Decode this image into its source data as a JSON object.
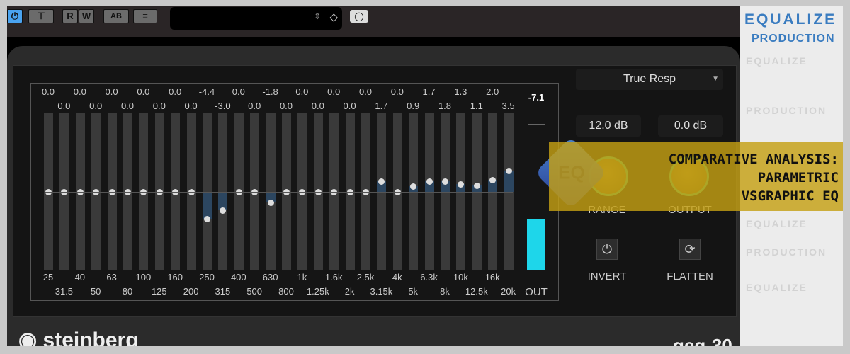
{
  "toolbar": {
    "buttons": [
      "power",
      "T",
      "R",
      "W",
      "AB",
      "≡"
    ],
    "preset_value": "",
    "camera": "camera-icon"
  },
  "bands": {
    "freqs": [
      "25",
      "31.5",
      "40",
      "50",
      "63",
      "80",
      "100",
      "125",
      "160",
      "200",
      "250",
      "315",
      "400",
      "500",
      "630",
      "800",
      "1k",
      "1.25k",
      "1.6k",
      "2k",
      "2.5k",
      "3.15k",
      "4k",
      "5k",
      "6.3k",
      "8k",
      "10k",
      "12.5k",
      "16k",
      "20k"
    ],
    "gains": [
      "0.0",
      "0.0",
      "0.0",
      "0.0",
      "0.0",
      "0.0",
      "0.0",
      "0.0",
      "0.0",
      "0.0",
      "-4.4",
      "-3.0",
      "0.0",
      "0.0",
      "-1.8",
      "0.0",
      "0.0",
      "0.0",
      "0.0",
      "0.0",
      "0.0",
      "1.7",
      "0.0",
      "0.9",
      "1.7",
      "1.8",
      "1.3",
      "1.1",
      "2.0",
      "3.5"
    ],
    "range_db": 12
  },
  "output_meter": {
    "label": "OUT",
    "peak": "-7.1",
    "level": 0.33,
    "color": "#1ed6ea"
  },
  "mode": {
    "selected": "True Resp"
  },
  "range": {
    "value": "12.0 dB",
    "label": "RANGE"
  },
  "output": {
    "value": "0.0 dB",
    "label": "OUTPUT"
  },
  "invert": {
    "label": "INVERT"
  },
  "flatten": {
    "label": "FLATTEN"
  },
  "footer": {
    "brand": "steinberg",
    "product": "geq-30"
  },
  "watermark": {
    "line1": "EQUALIZE",
    "line2": "PRODUCTION"
  },
  "banner": {
    "line1": "COMPARATIVE ANALYSIS:",
    "line2": "PARAMETRIC",
    "line3": "VSGRAPHIC EQ",
    "logo": "EQ"
  }
}
